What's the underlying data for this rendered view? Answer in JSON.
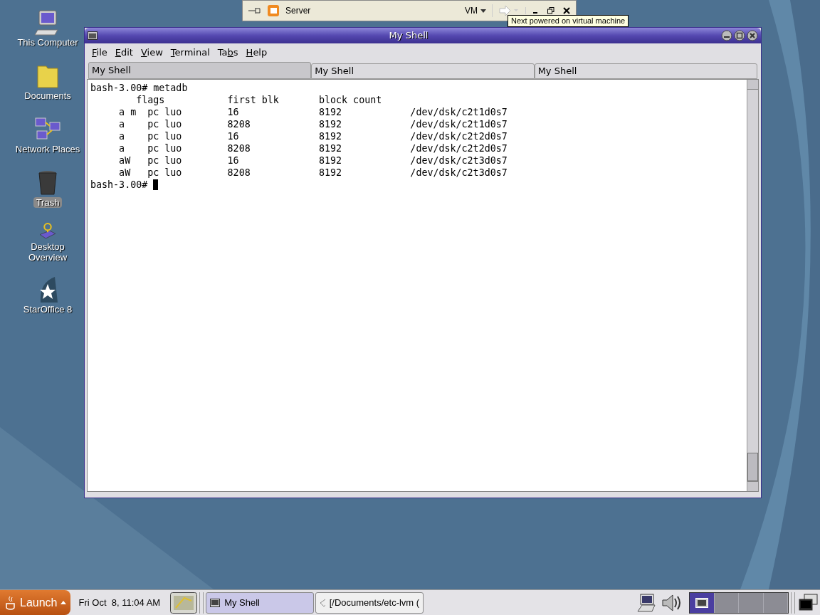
{
  "vm_bar": {
    "title": "Server",
    "menu": "VM",
    "tooltip": "Next powered on virtual machine"
  },
  "desktop_icons": [
    {
      "label": "This Computer",
      "kind": "computer",
      "selected": false
    },
    {
      "label": "Documents",
      "kind": "folder",
      "selected": false
    },
    {
      "label": "Network Places",
      "kind": "network",
      "selected": false
    },
    {
      "label": "Trash",
      "kind": "trash",
      "selected": true
    },
    {
      "label": "Desktop Overview",
      "kind": "help",
      "selected": false
    },
    {
      "label": "StarOffice 8",
      "kind": "office",
      "selected": false
    }
  ],
  "window": {
    "title": "My Shell",
    "menu": [
      {
        "key": "F",
        "rest": "ile"
      },
      {
        "key": "E",
        "rest": "dit"
      },
      {
        "key": "V",
        "rest": "iew"
      },
      {
        "key": "T",
        "rest": "erminal"
      },
      {
        "lead": "Ta",
        "key": "b",
        "rest": "s"
      },
      {
        "key": "H",
        "rest": "elp"
      }
    ],
    "tabs": [
      {
        "label": "My Shell",
        "selected": true
      },
      {
        "label": "My Shell",
        "selected": false
      },
      {
        "label": "My Shell",
        "selected": false
      }
    ],
    "terminal": {
      "lines": [
        "bash-3.00# metadb",
        "        flags           first blk       block count",
        "     a m  pc luo        16              8192            /dev/dsk/c2t1d0s7",
        "     a    pc luo        8208            8192            /dev/dsk/c2t1d0s7",
        "     a    pc luo        16              8192            /dev/dsk/c2t2d0s7",
        "     a    pc luo        8208            8192            /dev/dsk/c2t2d0s7",
        "     aW   pc luo        16              8192            /dev/dsk/c2t3d0s7",
        "     aW   pc luo        8208            8192            /dev/dsk/c2t3d0s7"
      ],
      "prompt": "bash-3.00#"
    }
  },
  "taskbar": {
    "launch": "Launch",
    "clock": "Fri Oct  8, 11:04 AM",
    "tasks": [
      {
        "label": "My Shell",
        "kind": "terminal",
        "selected": true
      },
      {
        "label": "[/Documents/etc-lvm (",
        "kind": "file",
        "selected": false
      }
    ],
    "workspaces": [
      {
        "selected": true
      },
      {
        "selected": false
      },
      {
        "selected": false
      },
      {
        "selected": false
      }
    ]
  }
}
